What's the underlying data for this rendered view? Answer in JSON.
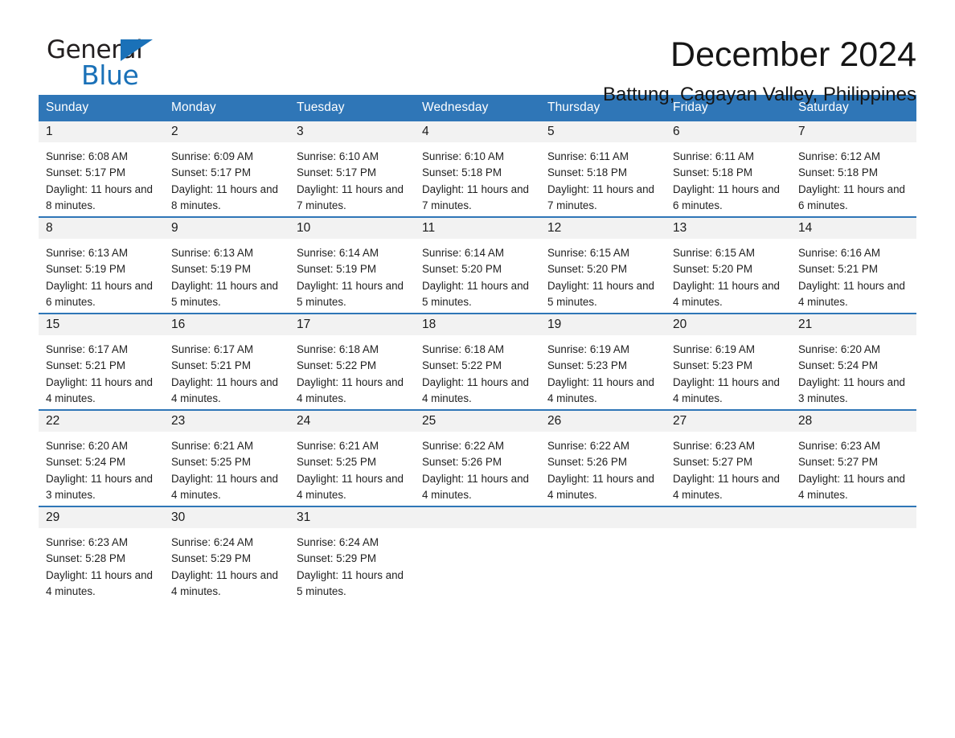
{
  "brand": {
    "name_part1": "General",
    "name_part2": "Blue",
    "accent_color": "#1a71b8"
  },
  "header": {
    "month_title": "December 2024",
    "location": "Battung, Cagayan Valley, Philippines"
  },
  "theme": {
    "header_blue": "#2f76b7",
    "daynum_band": "#f2f2f2",
    "text": "#1a1a1a"
  },
  "calendar": {
    "weekday_headers": [
      "Sunday",
      "Monday",
      "Tuesday",
      "Wednesday",
      "Thursday",
      "Friday",
      "Saturday"
    ],
    "weeks": [
      [
        {
          "day": "1",
          "details": "Sunrise: 6:08 AM\nSunset: 5:17 PM\nDaylight: 11 hours and 8 minutes."
        },
        {
          "day": "2",
          "details": "Sunrise: 6:09 AM\nSunset: 5:17 PM\nDaylight: 11 hours and 8 minutes."
        },
        {
          "day": "3",
          "details": "Sunrise: 6:10 AM\nSunset: 5:17 PM\nDaylight: 11 hours and 7 minutes."
        },
        {
          "day": "4",
          "details": "Sunrise: 6:10 AM\nSunset: 5:18 PM\nDaylight: 11 hours and 7 minutes."
        },
        {
          "day": "5",
          "details": "Sunrise: 6:11 AM\nSunset: 5:18 PM\nDaylight: 11 hours and 7 minutes."
        },
        {
          "day": "6",
          "details": "Sunrise: 6:11 AM\nSunset: 5:18 PM\nDaylight: 11 hours and 6 minutes."
        },
        {
          "day": "7",
          "details": "Sunrise: 6:12 AM\nSunset: 5:18 PM\nDaylight: 11 hours and 6 minutes."
        }
      ],
      [
        {
          "day": "8",
          "details": "Sunrise: 6:13 AM\nSunset: 5:19 PM\nDaylight: 11 hours and 6 minutes."
        },
        {
          "day": "9",
          "details": "Sunrise: 6:13 AM\nSunset: 5:19 PM\nDaylight: 11 hours and 5 minutes."
        },
        {
          "day": "10",
          "details": "Sunrise: 6:14 AM\nSunset: 5:19 PM\nDaylight: 11 hours and 5 minutes."
        },
        {
          "day": "11",
          "details": "Sunrise: 6:14 AM\nSunset: 5:20 PM\nDaylight: 11 hours and 5 minutes."
        },
        {
          "day": "12",
          "details": "Sunrise: 6:15 AM\nSunset: 5:20 PM\nDaylight: 11 hours and 5 minutes."
        },
        {
          "day": "13",
          "details": "Sunrise: 6:15 AM\nSunset: 5:20 PM\nDaylight: 11 hours and 4 minutes."
        },
        {
          "day": "14",
          "details": "Sunrise: 6:16 AM\nSunset: 5:21 PM\nDaylight: 11 hours and 4 minutes."
        }
      ],
      [
        {
          "day": "15",
          "details": "Sunrise: 6:17 AM\nSunset: 5:21 PM\nDaylight: 11 hours and 4 minutes."
        },
        {
          "day": "16",
          "details": "Sunrise: 6:17 AM\nSunset: 5:21 PM\nDaylight: 11 hours and 4 minutes."
        },
        {
          "day": "17",
          "details": "Sunrise: 6:18 AM\nSunset: 5:22 PM\nDaylight: 11 hours and 4 minutes."
        },
        {
          "day": "18",
          "details": "Sunrise: 6:18 AM\nSunset: 5:22 PM\nDaylight: 11 hours and 4 minutes."
        },
        {
          "day": "19",
          "details": "Sunrise: 6:19 AM\nSunset: 5:23 PM\nDaylight: 11 hours and 4 minutes."
        },
        {
          "day": "20",
          "details": "Sunrise: 6:19 AM\nSunset: 5:23 PM\nDaylight: 11 hours and 4 minutes."
        },
        {
          "day": "21",
          "details": "Sunrise: 6:20 AM\nSunset: 5:24 PM\nDaylight: 11 hours and 3 minutes."
        }
      ],
      [
        {
          "day": "22",
          "details": "Sunrise: 6:20 AM\nSunset: 5:24 PM\nDaylight: 11 hours and 3 minutes."
        },
        {
          "day": "23",
          "details": "Sunrise: 6:21 AM\nSunset: 5:25 PM\nDaylight: 11 hours and 4 minutes."
        },
        {
          "day": "24",
          "details": "Sunrise: 6:21 AM\nSunset: 5:25 PM\nDaylight: 11 hours and 4 minutes."
        },
        {
          "day": "25",
          "details": "Sunrise: 6:22 AM\nSunset: 5:26 PM\nDaylight: 11 hours and 4 minutes."
        },
        {
          "day": "26",
          "details": "Sunrise: 6:22 AM\nSunset: 5:26 PM\nDaylight: 11 hours and 4 minutes."
        },
        {
          "day": "27",
          "details": "Sunrise: 6:23 AM\nSunset: 5:27 PM\nDaylight: 11 hours and 4 minutes."
        },
        {
          "day": "28",
          "details": "Sunrise: 6:23 AM\nSunset: 5:27 PM\nDaylight: 11 hours and 4 minutes."
        }
      ],
      [
        {
          "day": "29",
          "details": "Sunrise: 6:23 AM\nSunset: 5:28 PM\nDaylight: 11 hours and 4 minutes."
        },
        {
          "day": "30",
          "details": "Sunrise: 6:24 AM\nSunset: 5:29 PM\nDaylight: 11 hours and 4 minutes."
        },
        {
          "day": "31",
          "details": "Sunrise: 6:24 AM\nSunset: 5:29 PM\nDaylight: 11 hours and 5 minutes."
        },
        {
          "day": "",
          "details": ""
        },
        {
          "day": "",
          "details": ""
        },
        {
          "day": "",
          "details": ""
        },
        {
          "day": "",
          "details": ""
        }
      ]
    ]
  }
}
